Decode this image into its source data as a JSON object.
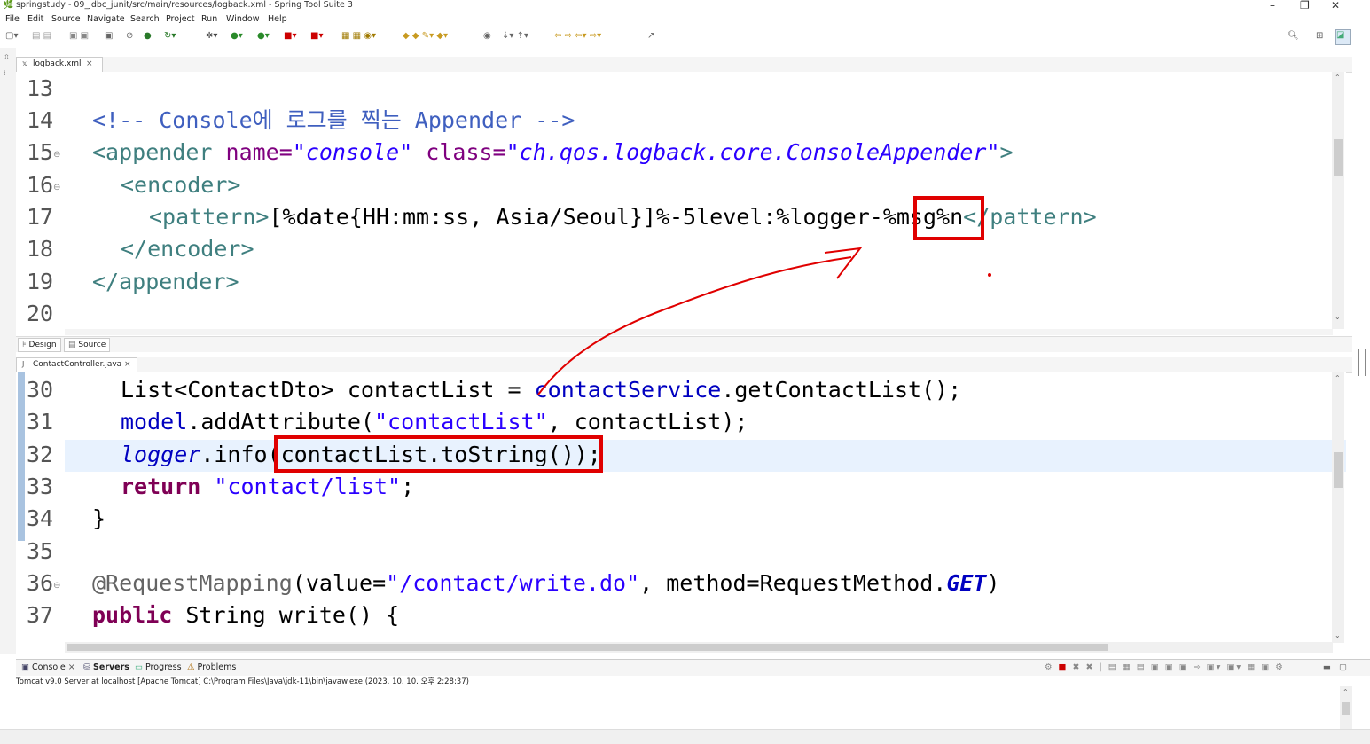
{
  "window": {
    "title": "springstudy - 09_jdbc_junit/src/main/resources/logback.xml - Spring Tool Suite 3",
    "minimize": "–",
    "restore": "❐",
    "close": "✕"
  },
  "menu": [
    "File",
    "Edit",
    "Source",
    "Navigate",
    "Search",
    "Project",
    "Run",
    "Window",
    "Help"
  ],
  "editor1": {
    "tab_label": "logback.xml",
    "lines": [
      {
        "n": "13",
        "text": ""
      },
      {
        "n": "14",
        "comment": "<!-- Console에 로그를 찍는 Appender -->"
      },
      {
        "n": "15",
        "tag_open": "<appender",
        "attr1": " name=",
        "val1": "\"console\"",
        "attr2": " class=",
        "val2": "\"ch.qos.logback.core.ConsoleAppender\"",
        "tag_close": ">"
      },
      {
        "n": "16",
        "tag": "<encoder>"
      },
      {
        "n": "17",
        "tag_open": "<pattern>",
        "text": "[%date{HH:mm:ss, Asia/Seoul}]%-5level:%logger-%msg%n",
        "tag_close": "</pattern>"
      },
      {
        "n": "18",
        "tag": "</encoder>"
      },
      {
        "n": "19",
        "tag": "</appender>"
      },
      {
        "n": "20",
        "text": ""
      }
    ]
  },
  "bottom_tabs": {
    "design": "Design",
    "source": "Source"
  },
  "editor2": {
    "tab_label": "ContactController.java",
    "lines": [
      {
        "n": "30",
        "t1": "List<ContactDto> contactList = ",
        "f1": "contactService",
        "t2": ".getContactList();"
      },
      {
        "n": "31",
        "f1": "model",
        "t2": ".addAttribute(",
        "s": "\"contactList\"",
        "t3": ", contactList);"
      },
      {
        "n": "32",
        "lg": "logger",
        "t2": ".info(contactList.toString());"
      },
      {
        "n": "33",
        "kw": "return",
        "s": " \"contact/list\"",
        "t3": ";"
      },
      {
        "n": "34",
        "t1": "}"
      },
      {
        "n": "35",
        "t1": ""
      },
      {
        "n": "36",
        "ann": "@RequestMapping",
        "t2": "(value=",
        "s": "\"/contact/write.do\"",
        "t3": ", method=RequestMethod.",
        "st": "GET",
        "t4": ")"
      },
      {
        "n": "37",
        "kw": "public",
        "t2": " String write() {"
      }
    ]
  },
  "console": {
    "tabs": [
      "Console",
      "Servers",
      "Progress",
      "Problems"
    ],
    "info": "Tomcat v9.0 Server at localhost [Apache Tomcat] C:\\Program Files\\Java\\jdk-11\\bin\\javaw.exe  (2023. 10. 10. 오후 2:28:37)"
  },
  "icons": {
    "app": "spring-leaf-icon",
    "search": "search-icon",
    "perspective": "perspective-icon"
  }
}
